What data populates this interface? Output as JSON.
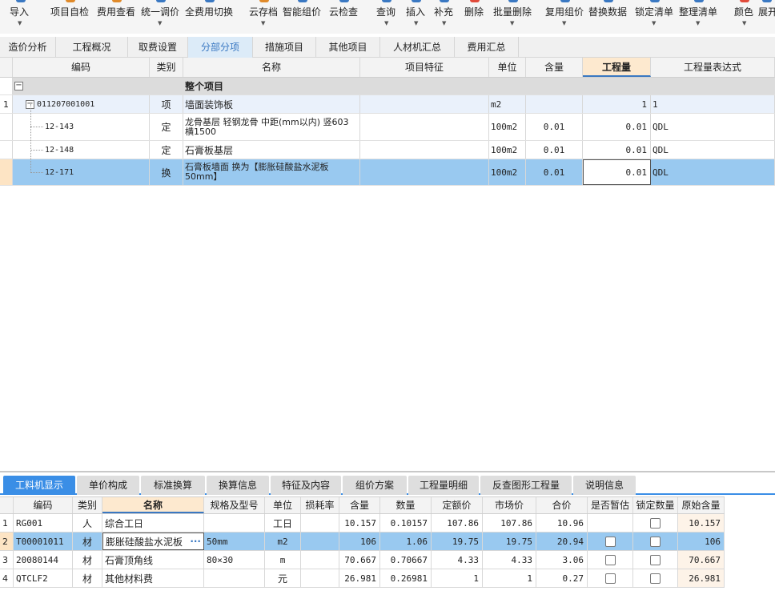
{
  "toolbar": {
    "buttons": [
      {
        "label": "导入",
        "icon": "import-icon",
        "color": "#3a78c2",
        "caret": true
      },
      {
        "label": "项目自检",
        "icon": "check-icon",
        "color": "#e08a2a",
        "caret": false
      },
      {
        "label": "费用查看",
        "icon": "fee-view-icon",
        "color": "#e08a2a",
        "caret": false
      },
      {
        "label": "统一调价",
        "icon": "price-adjust-icon",
        "color": "#3a78c2",
        "caret": true
      },
      {
        "label": "全费用切换",
        "icon": "switch-icon",
        "color": "#3a78c2",
        "caret": false
      },
      {
        "label": "云存档",
        "icon": "cloud-save-icon",
        "color": "#e08a2a",
        "caret": true
      },
      {
        "label": "智能组价",
        "icon": "smart-price-icon",
        "color": "#3a78c2",
        "caret": false
      },
      {
        "label": "云检查",
        "icon": "cloud-check-icon",
        "color": "#3a78c2",
        "caret": false
      },
      {
        "label": "查询",
        "icon": "search-icon",
        "color": "#3a78c2",
        "caret": true
      },
      {
        "label": "插入",
        "icon": "insert-icon",
        "color": "#3a78c2",
        "caret": true
      },
      {
        "label": "补充",
        "icon": "supplement-icon",
        "color": "#3a78c2",
        "caret": true
      },
      {
        "label": "删除",
        "icon": "delete-icon",
        "color": "#e04a3a",
        "caret": false
      },
      {
        "label": "批量删除",
        "icon": "batch-delete-icon",
        "color": "#3a78c2",
        "caret": true
      },
      {
        "label": "复用组价",
        "icon": "reuse-price-icon",
        "color": "#3a78c2",
        "caret": true
      },
      {
        "label": "替换数据",
        "icon": "replace-icon",
        "color": "#3a78c2",
        "caret": false
      },
      {
        "label": "锁定清单",
        "icon": "lock-icon",
        "color": "#3a78c2",
        "caret": true
      },
      {
        "label": "整理清单",
        "icon": "organize-icon",
        "color": "#3a78c2",
        "caret": true
      },
      {
        "label": "颜色",
        "icon": "color-icon",
        "color": "#e04a3a",
        "caret": true
      },
      {
        "label": "展开",
        "icon": "expand-icon",
        "color": "#3a78c2",
        "caret": false
      }
    ]
  },
  "main_tabs": [
    "造价分析",
    "工程概况",
    "取费设置",
    "分部分项",
    "措施项目",
    "其他项目",
    "人材机汇总",
    "费用汇总"
  ],
  "main_tab_active": 3,
  "grid": {
    "headers": [
      "编码",
      "类别",
      "名称",
      "项目特征",
      "单位",
      "含量",
      "工程量",
      "工程量表达式"
    ],
    "group_row": {
      "name": "整个项目"
    },
    "rows": [
      {
        "num": "1",
        "code": "011207001001",
        "type": "项",
        "name": "墙面装饰板",
        "unit": "m2",
        "content": "",
        "qty": "1",
        "expr": "1"
      },
      {
        "num": "",
        "code": "12-143",
        "type": "定",
        "name": "龙骨基层 轻钢龙骨 中距(mm以内) 竖603 横1500",
        "unit": "100m2",
        "content": "0.01",
        "qty": "0.01",
        "expr": "QDL"
      },
      {
        "num": "",
        "code": "12-148",
        "type": "定",
        "name": "石膏板基层",
        "unit": "100m2",
        "content": "0.01",
        "qty": "0.01",
        "expr": "QDL"
      },
      {
        "num": "",
        "code": "12-171",
        "type": "换",
        "name": "石膏板墙面  换为【膨胀硅酸盐水泥板 50mm】",
        "unit": "100m2",
        "content": "0.01",
        "qty": "0.01",
        "expr": "QDL"
      }
    ]
  },
  "bottom_tabs": [
    "工料机显示",
    "单价构成",
    "标准换算",
    "换算信息",
    "特征及内容",
    "组价方案",
    "工程量明细",
    "反查图形工程量",
    "说明信息"
  ],
  "bottom_tab_active": 0,
  "bottom_table": {
    "headers": [
      "编码",
      "类别",
      "名称",
      "规格及型号",
      "单位",
      "损耗率",
      "含量",
      "数量",
      "定额价",
      "市场价",
      "合价",
      "是否暂估",
      "锁定数量",
      "原始含量"
    ],
    "rows": [
      {
        "num": "1",
        "code": "RG001",
        "type": "人",
        "name": "综合工日",
        "spec": "",
        "unit": "工日",
        "loss": "",
        "content": "10.157",
        "qty": "0.10157",
        "quota": "107.86",
        "market": "107.86",
        "total": "10.96",
        "est": false,
        "lock": true,
        "orig": "10.157"
      },
      {
        "num": "2",
        "code": "T00001011",
        "type": "材",
        "name": "膨胀硅酸盐水泥板",
        "spec": "50mm",
        "unit": "m2",
        "loss": "",
        "content": "106",
        "qty": "1.06",
        "quota": "19.75",
        "market": "19.75",
        "total": "20.94",
        "est": true,
        "lock": true,
        "orig": "106"
      },
      {
        "num": "3",
        "code": "20080144",
        "type": "材",
        "name": "石膏顶角线",
        "spec": "80×30",
        "unit": "m",
        "loss": "",
        "content": "70.667",
        "qty": "0.70667",
        "quota": "4.33",
        "market": "4.33",
        "total": "3.06",
        "est": true,
        "lock": true,
        "orig": "70.667"
      },
      {
        "num": "4",
        "code": "QTCLF2",
        "type": "材",
        "name": "其他材料费",
        "spec": "",
        "unit": "元",
        "loss": "",
        "content": "26.981",
        "qty": "0.26981",
        "quota": "1",
        "market": "1",
        "total": "0.27",
        "est": true,
        "lock": true,
        "orig": "26.981"
      }
    ],
    "edit_dots": "···"
  },
  "colors": {
    "accent": "#3a8ee6",
    "selected_row": "#99c9f0",
    "active_tab_text": "#3a78c2"
  }
}
